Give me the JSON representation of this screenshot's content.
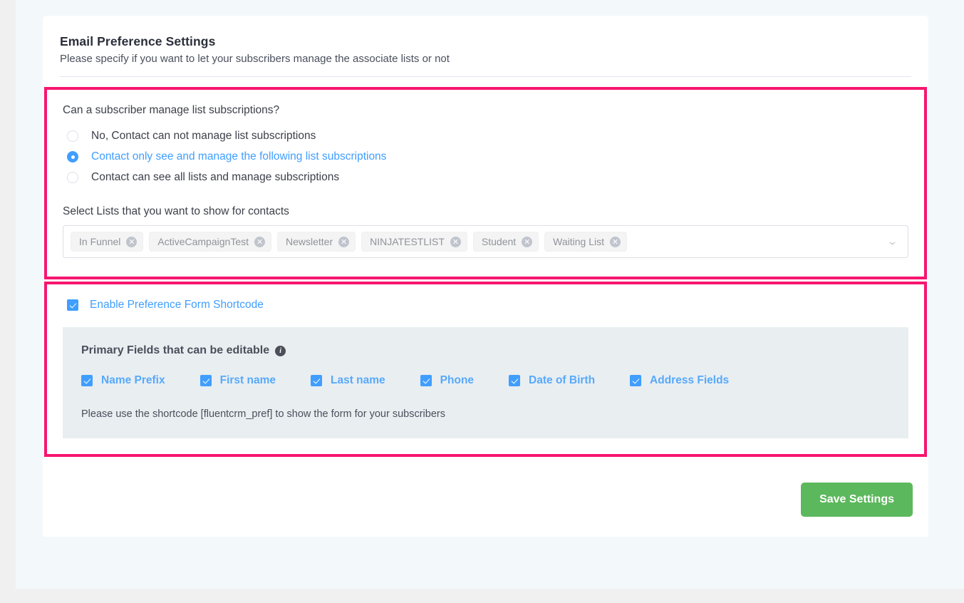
{
  "header": {
    "title": "Email Preference Settings",
    "subtitle": "Please specify if you want to let your subscribers manage the associate lists or not"
  },
  "subscription": {
    "question": "Can a subscriber manage list subscriptions?",
    "options": [
      {
        "label": "No, Contact can not manage list subscriptions",
        "selected": false
      },
      {
        "label": "Contact only see and manage the following list subscriptions",
        "selected": true
      },
      {
        "label": "Contact can see all lists and manage subscriptions",
        "selected": false
      }
    ],
    "select_label": "Select Lists that you want to show for contacts",
    "selected_lists": [
      "In Funnel",
      "ActiveCampaignTest",
      "Newsletter",
      "NINJATESTLIST",
      "Student",
      "Waiting List"
    ],
    "remove_glyph": "✕",
    "chevron_glyph": "⌄"
  },
  "shortcode": {
    "enable_label": "Enable Preference Form Shortcode",
    "enabled": true,
    "panel_title": "Primary Fields that can be editable",
    "info_glyph": "i",
    "fields": [
      {
        "label": "Name Prefix",
        "checked": true
      },
      {
        "label": "First name",
        "checked": true
      },
      {
        "label": "Last name",
        "checked": true
      },
      {
        "label": "Phone",
        "checked": true
      },
      {
        "label": "Date of Birth",
        "checked": true
      },
      {
        "label": "Address Fields",
        "checked": true
      }
    ],
    "hint": "Please use the shortcode [fluentcrm_pref] to show the form for your subscribers"
  },
  "footer": {
    "save_label": "Save Settings"
  },
  "colors": {
    "highlight": "#f7166f",
    "accent": "#409eff",
    "save": "#5cb85c"
  }
}
